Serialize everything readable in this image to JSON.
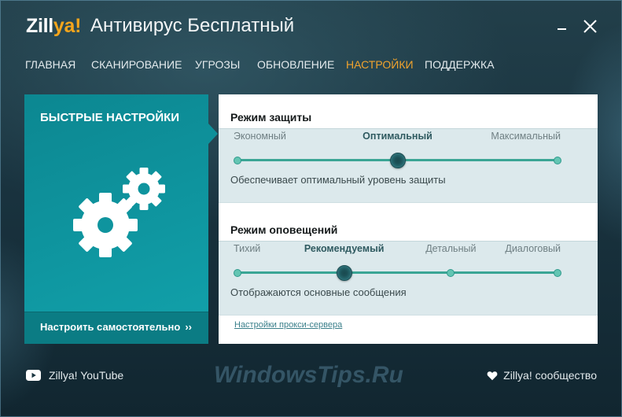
{
  "app": {
    "logo_white": "Zill",
    "logo_accent": "ya!",
    "title": "Антивирус Бесплатный",
    "icons": {
      "minimize": "minimize-icon",
      "close": "close-icon"
    }
  },
  "nav": [
    {
      "label": "ГЛАВНАЯ",
      "active": false
    },
    {
      "label": "СКАНИРОВАНИЕ",
      "active": false
    },
    {
      "label": "УГРОЗЫ",
      "active": false
    },
    {
      "label": "ОБНОВЛЕНИЕ",
      "active": false
    },
    {
      "label": "НАСТРОЙКИ",
      "active": true
    },
    {
      "label": "ПОДДЕРЖКА",
      "active": false
    }
  ],
  "quick_settings": {
    "title": "БЫСТРЫЕ НАСТРОЙКИ",
    "icon": "gears-icon",
    "customize_label": "Настроить самостоятельно",
    "customize_arrow": "››"
  },
  "protection": {
    "title": "Режим защиты",
    "levels": [
      "Экономный",
      "Оптимальный",
      "Максимальный"
    ],
    "selected_index": 1,
    "description": "Обеспечивает оптимальный уровень защиты"
  },
  "notifications": {
    "title": "Режим оповещений",
    "levels": [
      "Тихий",
      "Рекомендуемый",
      "Детальный",
      "Диалоговый"
    ],
    "selected_index": 1,
    "description": "Отображаются основные сообщения"
  },
  "proxy_link": "Настройки прокси-сервера",
  "footer": {
    "youtube_label": "Zillya! YouTube",
    "youtube_icon": "youtube-icon",
    "community_label": "Zillya! сообщество",
    "community_icon": "heart-icon",
    "watermark": "WindowsTips.Ru"
  },
  "colors": {
    "accent": "#f0a32e",
    "panel_teal": "#0f939c",
    "slider": "#3aa595",
    "knob": "#24646b"
  }
}
